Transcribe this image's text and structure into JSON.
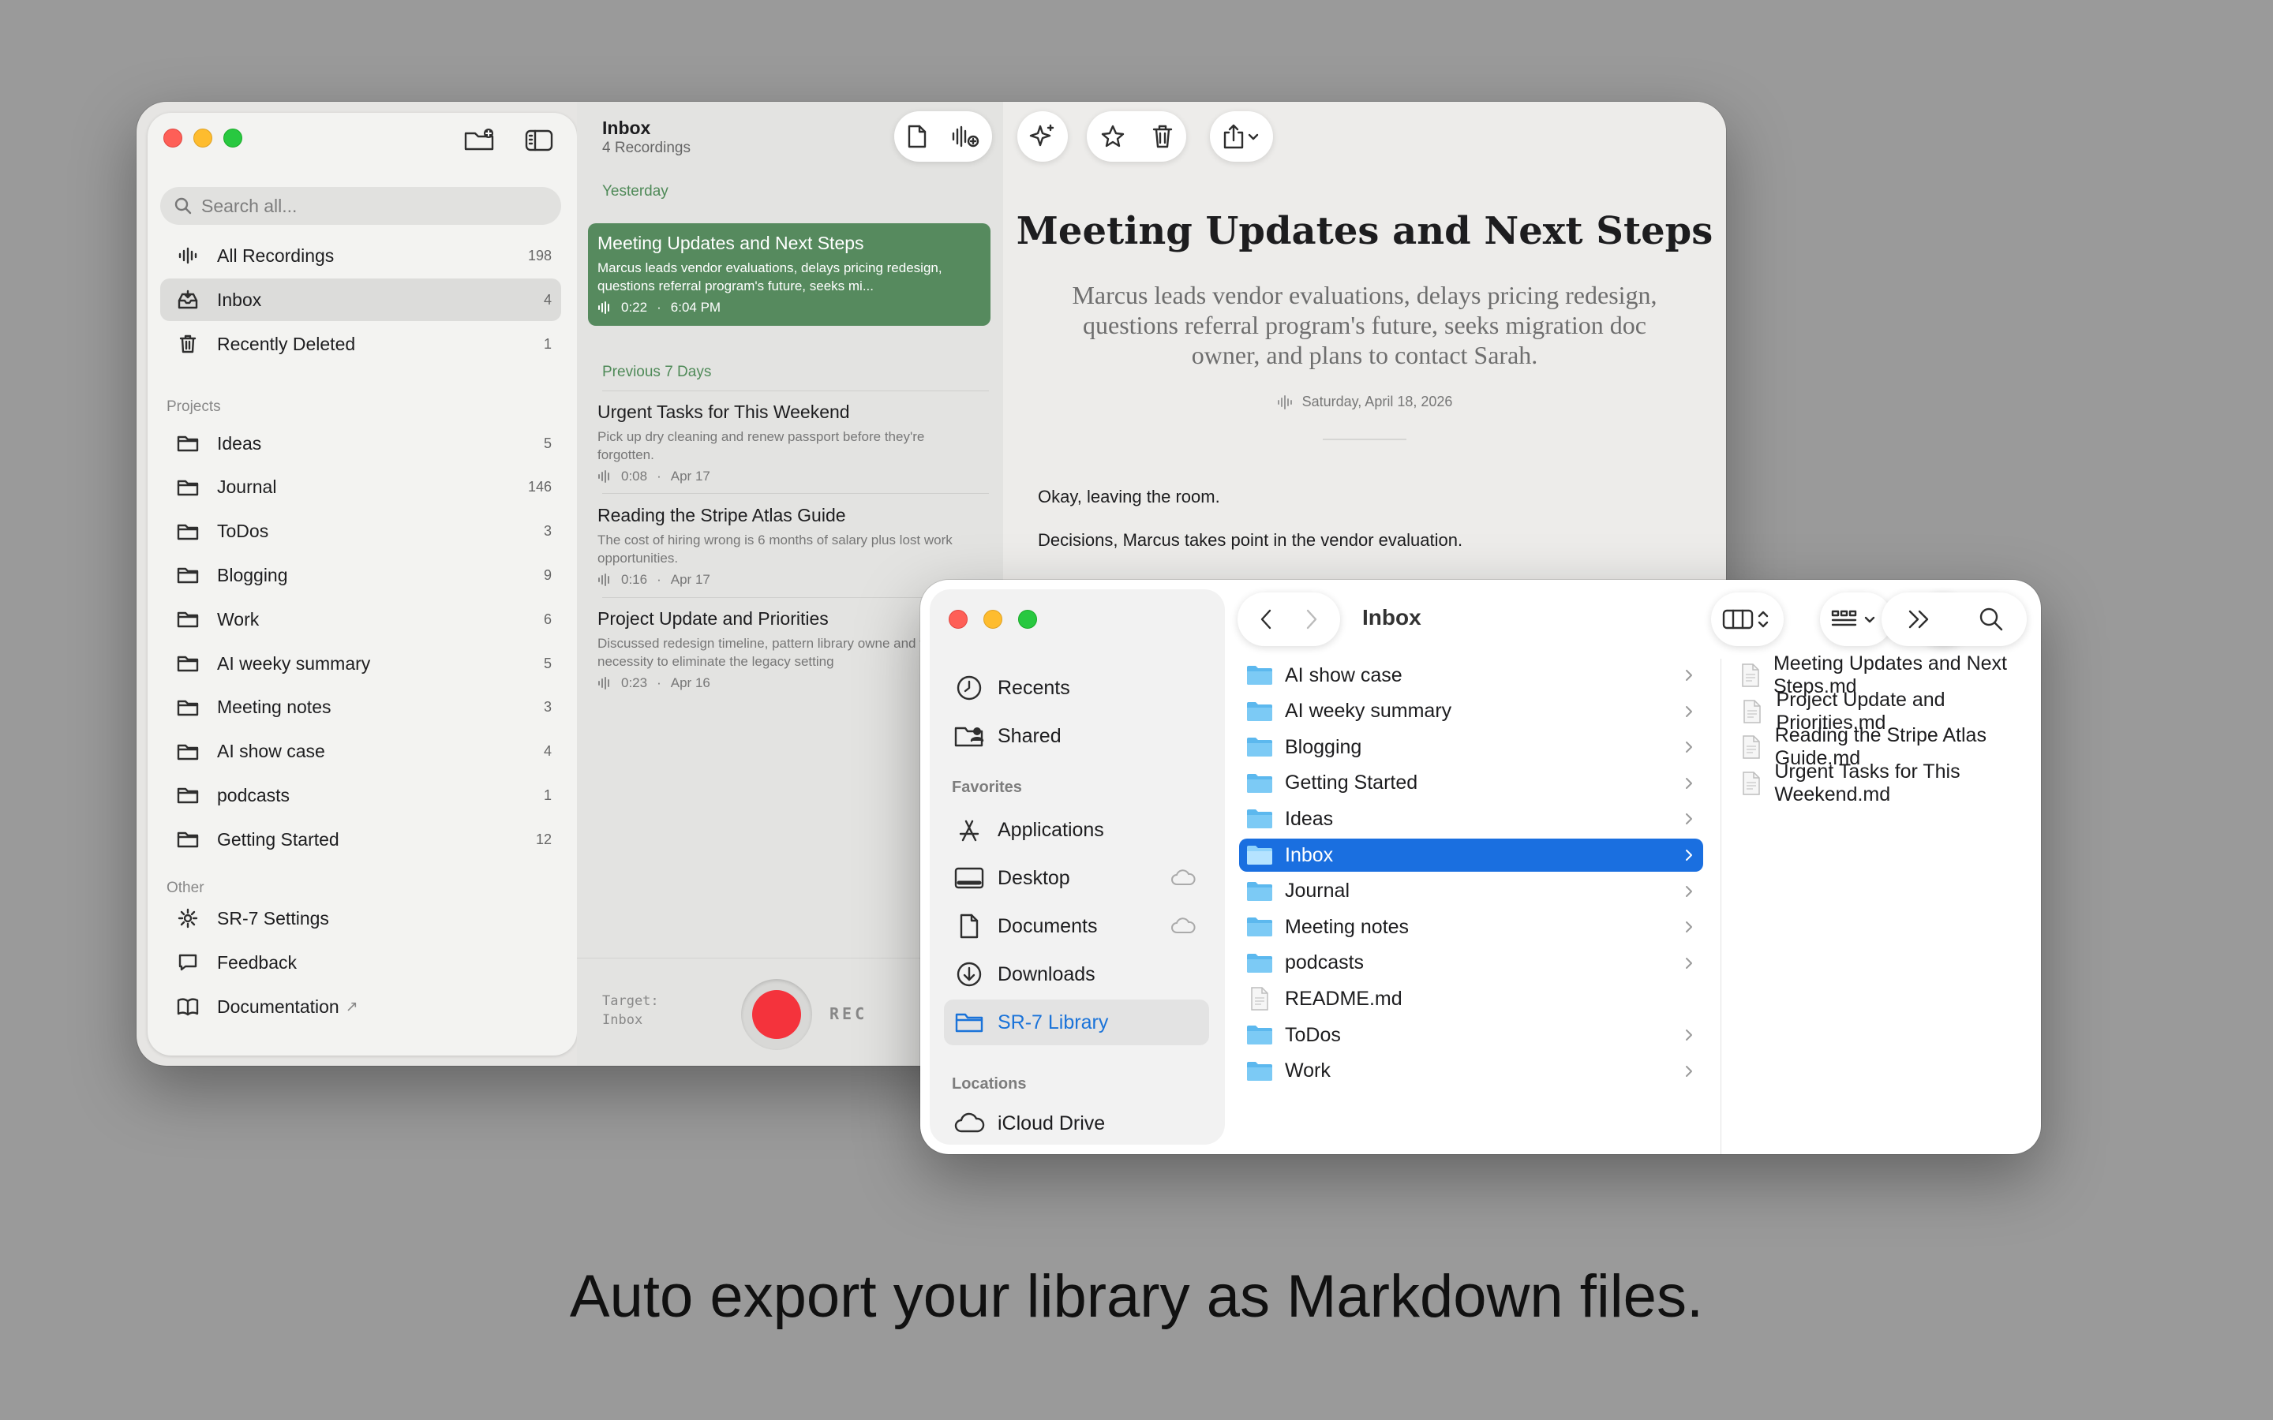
{
  "app": {
    "search_placeholder": "Search all...",
    "library": [
      {
        "label": "All Recordings",
        "count": "198",
        "icon": "waveform-icon"
      },
      {
        "label": "Inbox",
        "count": "4",
        "icon": "inbox-icon"
      },
      {
        "label": "Recently Deleted",
        "count": "1",
        "icon": "trash-icon"
      }
    ],
    "projects_header": "Projects",
    "projects": [
      {
        "label": "Ideas",
        "count": "5"
      },
      {
        "label": "Journal",
        "count": "146"
      },
      {
        "label": "ToDos",
        "count": "3"
      },
      {
        "label": "Blogging",
        "count": "9"
      },
      {
        "label": "Work",
        "count": "6"
      },
      {
        "label": "AI weeky summary",
        "count": "5"
      },
      {
        "label": "Meeting notes",
        "count": "3"
      },
      {
        "label": "AI show case",
        "count": "4"
      },
      {
        "label": "podcasts",
        "count": "1"
      },
      {
        "label": "Getting Started",
        "count": "12"
      }
    ],
    "other_header": "Other",
    "other": [
      {
        "label": "SR-7 Settings",
        "icon": "gear-icon"
      },
      {
        "label": "Feedback",
        "icon": "speech-bubble-icon"
      },
      {
        "label": "Documentation",
        "icon": "book-icon",
        "suffix": "↗"
      }
    ],
    "list": {
      "title": "Inbox",
      "subtitle": "4 Recordings",
      "group_yesterday": "Yesterday",
      "group_previous": "Previous 7 Days",
      "recordings": [
        {
          "title": "Meeting Updates and Next Steps",
          "summary": "Marcus leads vendor evaluations, delays pricing redesign, questions referral program's future, seeks mi...",
          "duration": "0:22",
          "date": "6:04 PM"
        },
        {
          "title": "Urgent Tasks for This Weekend",
          "summary": "Pick up dry cleaning and renew passport before they're forgotten.",
          "duration": "0:08",
          "date": "Apr 17"
        },
        {
          "title": "Reading the Stripe Atlas Guide",
          "summary": "The cost of hiring wrong is 6 months of salary plus lost work opportunities.",
          "duration": "0:16",
          "date": "Apr 17"
        },
        {
          "title": "Project Update and Priorities",
          "summary": "Discussed redesign timeline, pattern library owne and the necessity to eliminate the legacy setting",
          "duration": "0:23",
          "date": "Apr 16"
        }
      ],
      "target_label": "Target:",
      "target_value": "Inbox",
      "rec_label": "REC"
    },
    "detail": {
      "title": "Meeting Updates and Next Steps",
      "summary": "Marcus leads vendor evaluations, delays pricing redesign, questions referral program's future, seeks migration doc owner, and plans to contact Sarah.",
      "date": "Saturday, April 18, 2026",
      "paragraphs": [
        "Okay, leaving the room.",
        "Decisions, Marcus takes point in the vendor evaluation."
      ]
    }
  },
  "finder": {
    "title": "Inbox",
    "sidebar": {
      "top": [
        {
          "label": "Recents",
          "icon": "clock-icon"
        },
        {
          "label": "Shared",
          "icon": "shared-folder-icon"
        }
      ],
      "favorites_header": "Favorites",
      "favorites": [
        {
          "label": "Applications",
          "icon": "applications-icon"
        },
        {
          "label": "Desktop",
          "icon": "desktop-icon"
        },
        {
          "label": "Documents",
          "icon": "document-icon"
        },
        {
          "label": "Downloads",
          "icon": "download-icon"
        },
        {
          "label": "SR-7 Library",
          "icon": "folder-icon"
        }
      ],
      "locations_header": "Locations",
      "locations": [
        {
          "label": "iCloud Drive",
          "icon": "cloud-icon"
        }
      ]
    },
    "column1": [
      {
        "label": "AI show case",
        "kind": "folder"
      },
      {
        "label": "AI weeky summary",
        "kind": "folder"
      },
      {
        "label": "Blogging",
        "kind": "folder"
      },
      {
        "label": "Getting Started",
        "kind": "folder"
      },
      {
        "label": "Ideas",
        "kind": "folder"
      },
      {
        "label": "Inbox",
        "kind": "folder"
      },
      {
        "label": "Journal",
        "kind": "folder"
      },
      {
        "label": "Meeting notes",
        "kind": "folder"
      },
      {
        "label": "podcasts",
        "kind": "folder"
      },
      {
        "label": "README.md",
        "kind": "file"
      },
      {
        "label": "ToDos",
        "kind": "folder"
      },
      {
        "label": "Work",
        "kind": "folder"
      }
    ],
    "column2": [
      {
        "label": "Meeting Updates and Next Steps.md"
      },
      {
        "label": "Project Update and Priorities.md"
      },
      {
        "label": "Reading the Stripe Atlas Guide.md"
      },
      {
        "label": "Urgent Tasks for This Weekend.md"
      }
    ]
  },
  "caption": "Auto export your library as Markdown files."
}
